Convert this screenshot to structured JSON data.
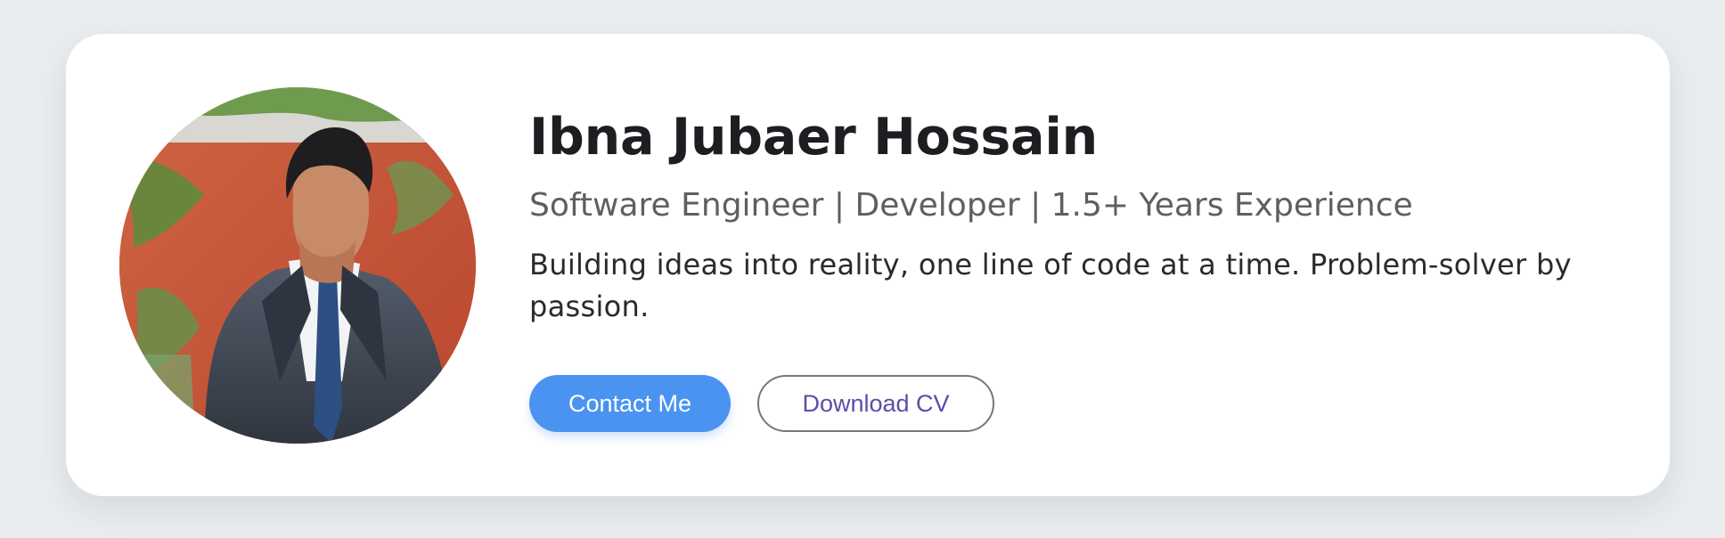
{
  "profile": {
    "name": "Ibna Jubaer Hossain",
    "subtitle": "Software Engineer | Developer | 1.5+ Years Experience",
    "bio": "Building ideas into reality, one line of code at a time. Problem-solver by passion.",
    "avatar": "profile-photo"
  },
  "actions": {
    "contact_label": "Contact Me",
    "download_label": "Download CV"
  },
  "colors": {
    "background": "#e9edf0",
    "card": "#ffffff",
    "accent": "#4a93f0",
    "secondary_text": "#5a4ea8"
  }
}
